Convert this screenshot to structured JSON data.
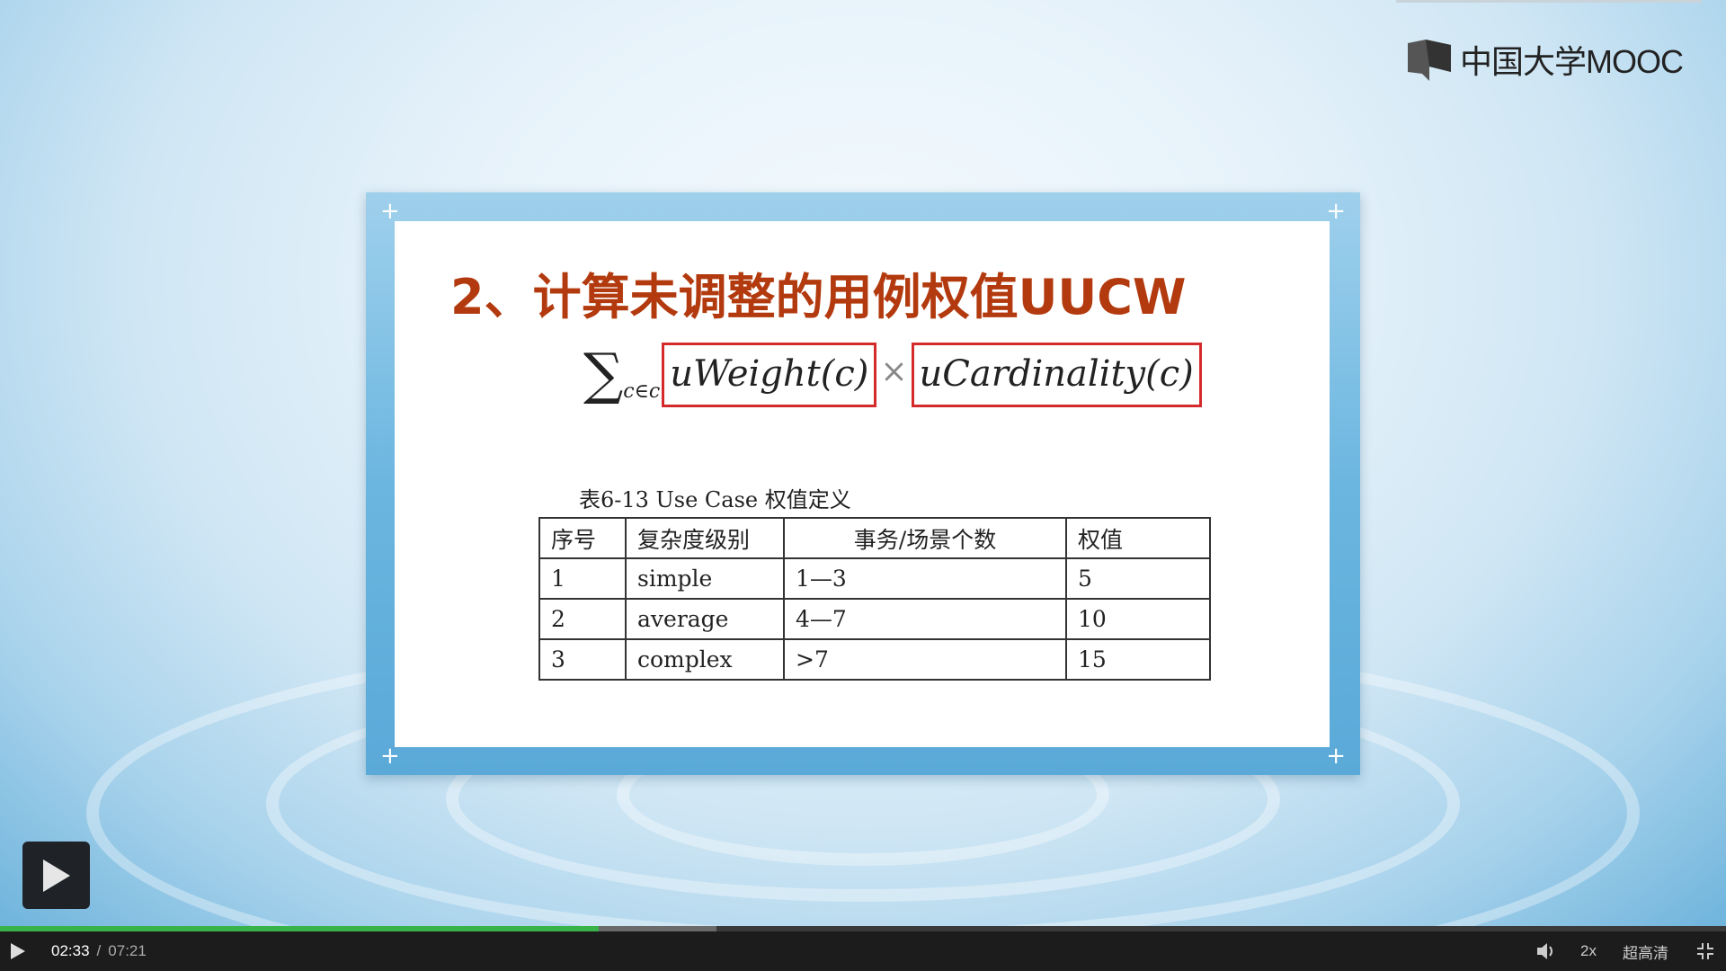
{
  "player": {
    "brand": "中国大学MOOC",
    "current_time": "02:33",
    "separator": "/",
    "total_time": "07:21",
    "played_fraction": 0.347,
    "buffered_fraction": 0.415,
    "speed_label": "2x",
    "quality_label": "超高清"
  },
  "slide": {
    "title": "2、计算未调整的用例权值UUCW",
    "formula": {
      "sum_symbol": "∑",
      "sum_subscript": "c∈c",
      "term1": "uWeight(c)",
      "operator": "×",
      "term2": "uCardinality(c)"
    },
    "table_caption": "表6-13 Use Case 权值定义",
    "table": {
      "headers": [
        "序号",
        "复杂度级别",
        "事务/场景个数",
        "权值"
      ],
      "rows": [
        [
          "1",
          "simple",
          "1—3",
          "5"
        ],
        [
          "2",
          "average",
          "4—7",
          "10"
        ],
        [
          "3",
          "complex",
          ">7",
          "15"
        ]
      ]
    }
  },
  "colors": {
    "title": "#b23a0e",
    "highlight_box": "#d42a2a",
    "progress_played": "#38b34a"
  },
  "icons": {
    "play": "play-icon",
    "big_play": "big-play-icon",
    "volume": "volume-icon",
    "fullscreen": "fullscreen-exit-icon",
    "logo": "mooc-book-logo-icon"
  }
}
